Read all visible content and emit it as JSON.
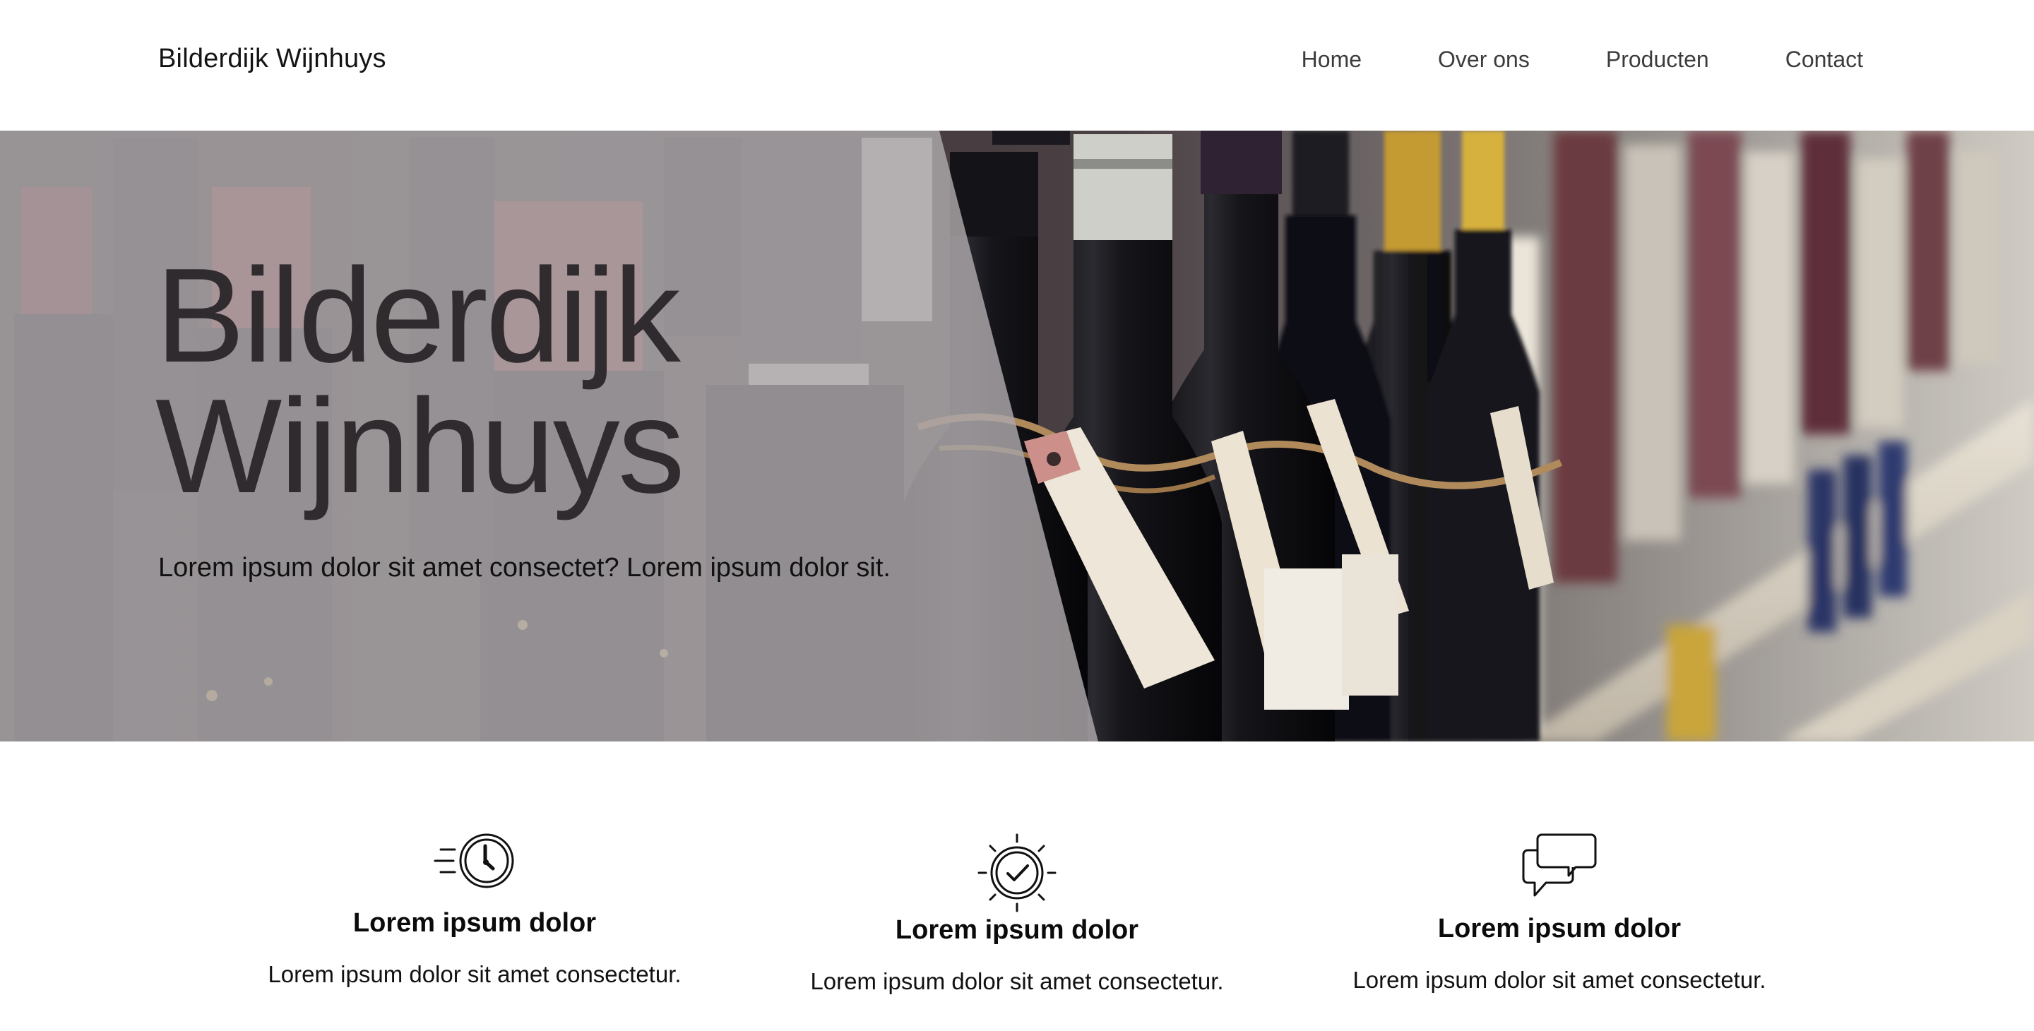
{
  "header": {
    "brand": "Bilderdijk Wijnhuys",
    "nav": [
      {
        "label": "Home"
      },
      {
        "label": "Over ons"
      },
      {
        "label": "Producten"
      },
      {
        "label": "Contact"
      }
    ]
  },
  "hero": {
    "title_line1": "Bilderdijk",
    "title_line2": "Wijnhuys",
    "subtitle": "Lorem ipsum dolor sit amet consectet? Lorem ipsum dolor sit.",
    "image": "wine-bottles-with-tags-photo"
  },
  "features": [
    {
      "icon": "fast-clock-icon",
      "title": "Lorem ipsum dolor",
      "text": "Lorem ipsum dolor sit amet consectetur."
    },
    {
      "icon": "verified-badge-icon",
      "title": "Lorem ipsum dolor",
      "text": "Lorem ipsum dolor sit amet consectetur."
    },
    {
      "icon": "chat-bubbles-icon",
      "title": "Lorem ipsum dolor",
      "text": "Lorem ipsum dolor sit amet consectetur."
    }
  ],
  "colors": {
    "hero_title": "#302b2e",
    "overlay": "#aaa6a8",
    "text": "#111111",
    "nav_text": "#3c3c3c"
  }
}
